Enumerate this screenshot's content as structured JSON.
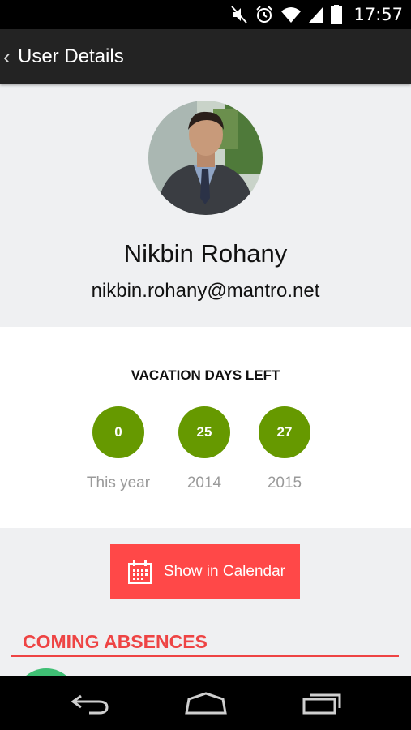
{
  "status_bar": {
    "time": "17:57",
    "icons": [
      "mute-icon",
      "alarm-icon",
      "wifi-icon",
      "signal-icon",
      "battery-icon"
    ]
  },
  "action_bar": {
    "title": "User Details",
    "back_icon": "chevron-left-icon"
  },
  "profile": {
    "name": "Nikbin Rohany",
    "email": "nikbin.rohany@mantro.net"
  },
  "vacation": {
    "title": "VACATION DAYS LEFT",
    "items": [
      {
        "value": "0",
        "label": "This year"
      },
      {
        "value": "25",
        "label": "2014"
      },
      {
        "value": "27",
        "label": "2015"
      }
    ]
  },
  "calendar_button": {
    "label": "Show in Calendar",
    "icon": "calendar-icon"
  },
  "absences": {
    "heading": "COMING ABSENCES"
  },
  "nav_bar": {
    "icons": [
      "back-nav-icon",
      "home-nav-icon",
      "recents-nav-icon"
    ]
  },
  "colors": {
    "accent_red": "#ff4848",
    "heading_red": "#ee4444",
    "counter_green": "#669900",
    "action_bar": "#232323"
  }
}
